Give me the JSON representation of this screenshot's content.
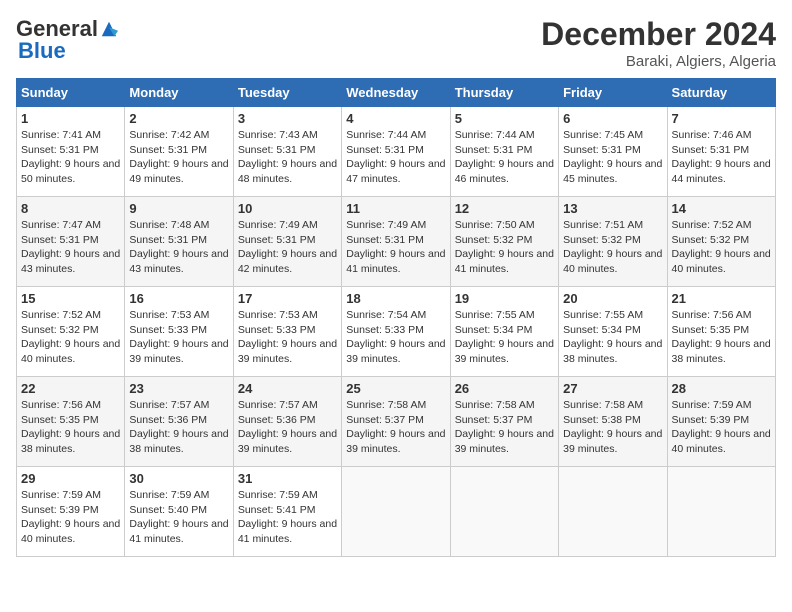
{
  "logo": {
    "general": "General",
    "blue": "Blue"
  },
  "title": {
    "month_year": "December 2024",
    "location": "Baraki, Algiers, Algeria"
  },
  "weekdays": [
    "Sunday",
    "Monday",
    "Tuesday",
    "Wednesday",
    "Thursday",
    "Friday",
    "Saturday"
  ],
  "weeks": [
    [
      {
        "day": "1",
        "sunrise": "7:41 AM",
        "sunset": "5:31 PM",
        "daylight": "9 hours and 50 minutes."
      },
      {
        "day": "2",
        "sunrise": "7:42 AM",
        "sunset": "5:31 PM",
        "daylight": "9 hours and 49 minutes."
      },
      {
        "day": "3",
        "sunrise": "7:43 AM",
        "sunset": "5:31 PM",
        "daylight": "9 hours and 48 minutes."
      },
      {
        "day": "4",
        "sunrise": "7:44 AM",
        "sunset": "5:31 PM",
        "daylight": "9 hours and 47 minutes."
      },
      {
        "day": "5",
        "sunrise": "7:44 AM",
        "sunset": "5:31 PM",
        "daylight": "9 hours and 46 minutes."
      },
      {
        "day": "6",
        "sunrise": "7:45 AM",
        "sunset": "5:31 PM",
        "daylight": "9 hours and 45 minutes."
      },
      {
        "day": "7",
        "sunrise": "7:46 AM",
        "sunset": "5:31 PM",
        "daylight": "9 hours and 44 minutes."
      }
    ],
    [
      {
        "day": "8",
        "sunrise": "7:47 AM",
        "sunset": "5:31 PM",
        "daylight": "9 hours and 43 minutes."
      },
      {
        "day": "9",
        "sunrise": "7:48 AM",
        "sunset": "5:31 PM",
        "daylight": "9 hours and 43 minutes."
      },
      {
        "day": "10",
        "sunrise": "7:49 AM",
        "sunset": "5:31 PM",
        "daylight": "9 hours and 42 minutes."
      },
      {
        "day": "11",
        "sunrise": "7:49 AM",
        "sunset": "5:31 PM",
        "daylight": "9 hours and 41 minutes."
      },
      {
        "day": "12",
        "sunrise": "7:50 AM",
        "sunset": "5:32 PM",
        "daylight": "9 hours and 41 minutes."
      },
      {
        "day": "13",
        "sunrise": "7:51 AM",
        "sunset": "5:32 PM",
        "daylight": "9 hours and 40 minutes."
      },
      {
        "day": "14",
        "sunrise": "7:52 AM",
        "sunset": "5:32 PM",
        "daylight": "9 hours and 40 minutes."
      }
    ],
    [
      {
        "day": "15",
        "sunrise": "7:52 AM",
        "sunset": "5:32 PM",
        "daylight": "9 hours and 40 minutes."
      },
      {
        "day": "16",
        "sunrise": "7:53 AM",
        "sunset": "5:33 PM",
        "daylight": "9 hours and 39 minutes."
      },
      {
        "day": "17",
        "sunrise": "7:53 AM",
        "sunset": "5:33 PM",
        "daylight": "9 hours and 39 minutes."
      },
      {
        "day": "18",
        "sunrise": "7:54 AM",
        "sunset": "5:33 PM",
        "daylight": "9 hours and 39 minutes."
      },
      {
        "day": "19",
        "sunrise": "7:55 AM",
        "sunset": "5:34 PM",
        "daylight": "9 hours and 39 minutes."
      },
      {
        "day": "20",
        "sunrise": "7:55 AM",
        "sunset": "5:34 PM",
        "daylight": "9 hours and 38 minutes."
      },
      {
        "day": "21",
        "sunrise": "7:56 AM",
        "sunset": "5:35 PM",
        "daylight": "9 hours and 38 minutes."
      }
    ],
    [
      {
        "day": "22",
        "sunrise": "7:56 AM",
        "sunset": "5:35 PM",
        "daylight": "9 hours and 38 minutes."
      },
      {
        "day": "23",
        "sunrise": "7:57 AM",
        "sunset": "5:36 PM",
        "daylight": "9 hours and 38 minutes."
      },
      {
        "day": "24",
        "sunrise": "7:57 AM",
        "sunset": "5:36 PM",
        "daylight": "9 hours and 39 minutes."
      },
      {
        "day": "25",
        "sunrise": "7:58 AM",
        "sunset": "5:37 PM",
        "daylight": "9 hours and 39 minutes."
      },
      {
        "day": "26",
        "sunrise": "7:58 AM",
        "sunset": "5:37 PM",
        "daylight": "9 hours and 39 minutes."
      },
      {
        "day": "27",
        "sunrise": "7:58 AM",
        "sunset": "5:38 PM",
        "daylight": "9 hours and 39 minutes."
      },
      {
        "day": "28",
        "sunrise": "7:59 AM",
        "sunset": "5:39 PM",
        "daylight": "9 hours and 40 minutes."
      }
    ],
    [
      {
        "day": "29",
        "sunrise": "7:59 AM",
        "sunset": "5:39 PM",
        "daylight": "9 hours and 40 minutes."
      },
      {
        "day": "30",
        "sunrise": "7:59 AM",
        "sunset": "5:40 PM",
        "daylight": "9 hours and 41 minutes."
      },
      {
        "day": "31",
        "sunrise": "7:59 AM",
        "sunset": "5:41 PM",
        "daylight": "9 hours and 41 minutes."
      },
      null,
      null,
      null,
      null
    ]
  ],
  "labels": {
    "sunrise": "Sunrise:",
    "sunset": "Sunset:",
    "daylight": "Daylight:"
  }
}
